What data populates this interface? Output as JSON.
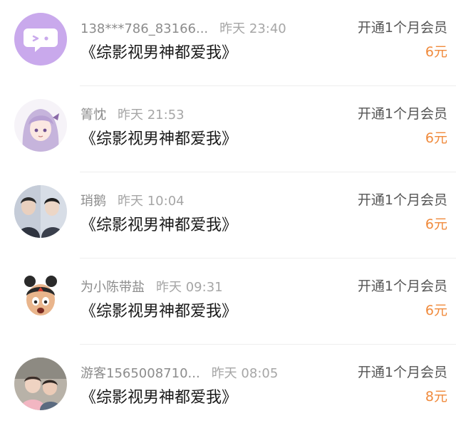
{
  "records": [
    {
      "user": "138***786_83166...",
      "time": "昨天 23:40",
      "title": "《综影视男神都爱我》",
      "desc": "开通1个月会员",
      "amount": "6元",
      "avatar_icon": "default-chat-avatar-icon"
    },
    {
      "user": "箐忱",
      "time": "昨天 21:53",
      "title": "《综影视男神都爱我》",
      "desc": "开通1个月会员",
      "amount": "6元",
      "avatar_icon": "anime-girl-avatar-icon"
    },
    {
      "user": "琑鹅",
      "time": "昨天 10:04",
      "title": "《综影视男神都爱我》",
      "desc": "开通1个月会员",
      "amount": "6元",
      "avatar_icon": "couple-photo-avatar-icon"
    },
    {
      "user": "为小陈带盐",
      "time": "昨天 09:31",
      "title": "《综影视男神都爱我》",
      "desc": "开通1个月会员",
      "amount": "6元",
      "avatar_icon": "cartoon-boy-avatar-icon"
    },
    {
      "user": "游客1565008710...",
      "time": "昨天 08:05",
      "title": "《综影视男神都爱我》",
      "desc": "开通1个月会员",
      "amount": "8元",
      "avatar_icon": "kids-photo-avatar-icon"
    }
  ],
  "colors": {
    "accent": "#f08a3c",
    "default_avatar_bg": "#c9a9ec"
  }
}
